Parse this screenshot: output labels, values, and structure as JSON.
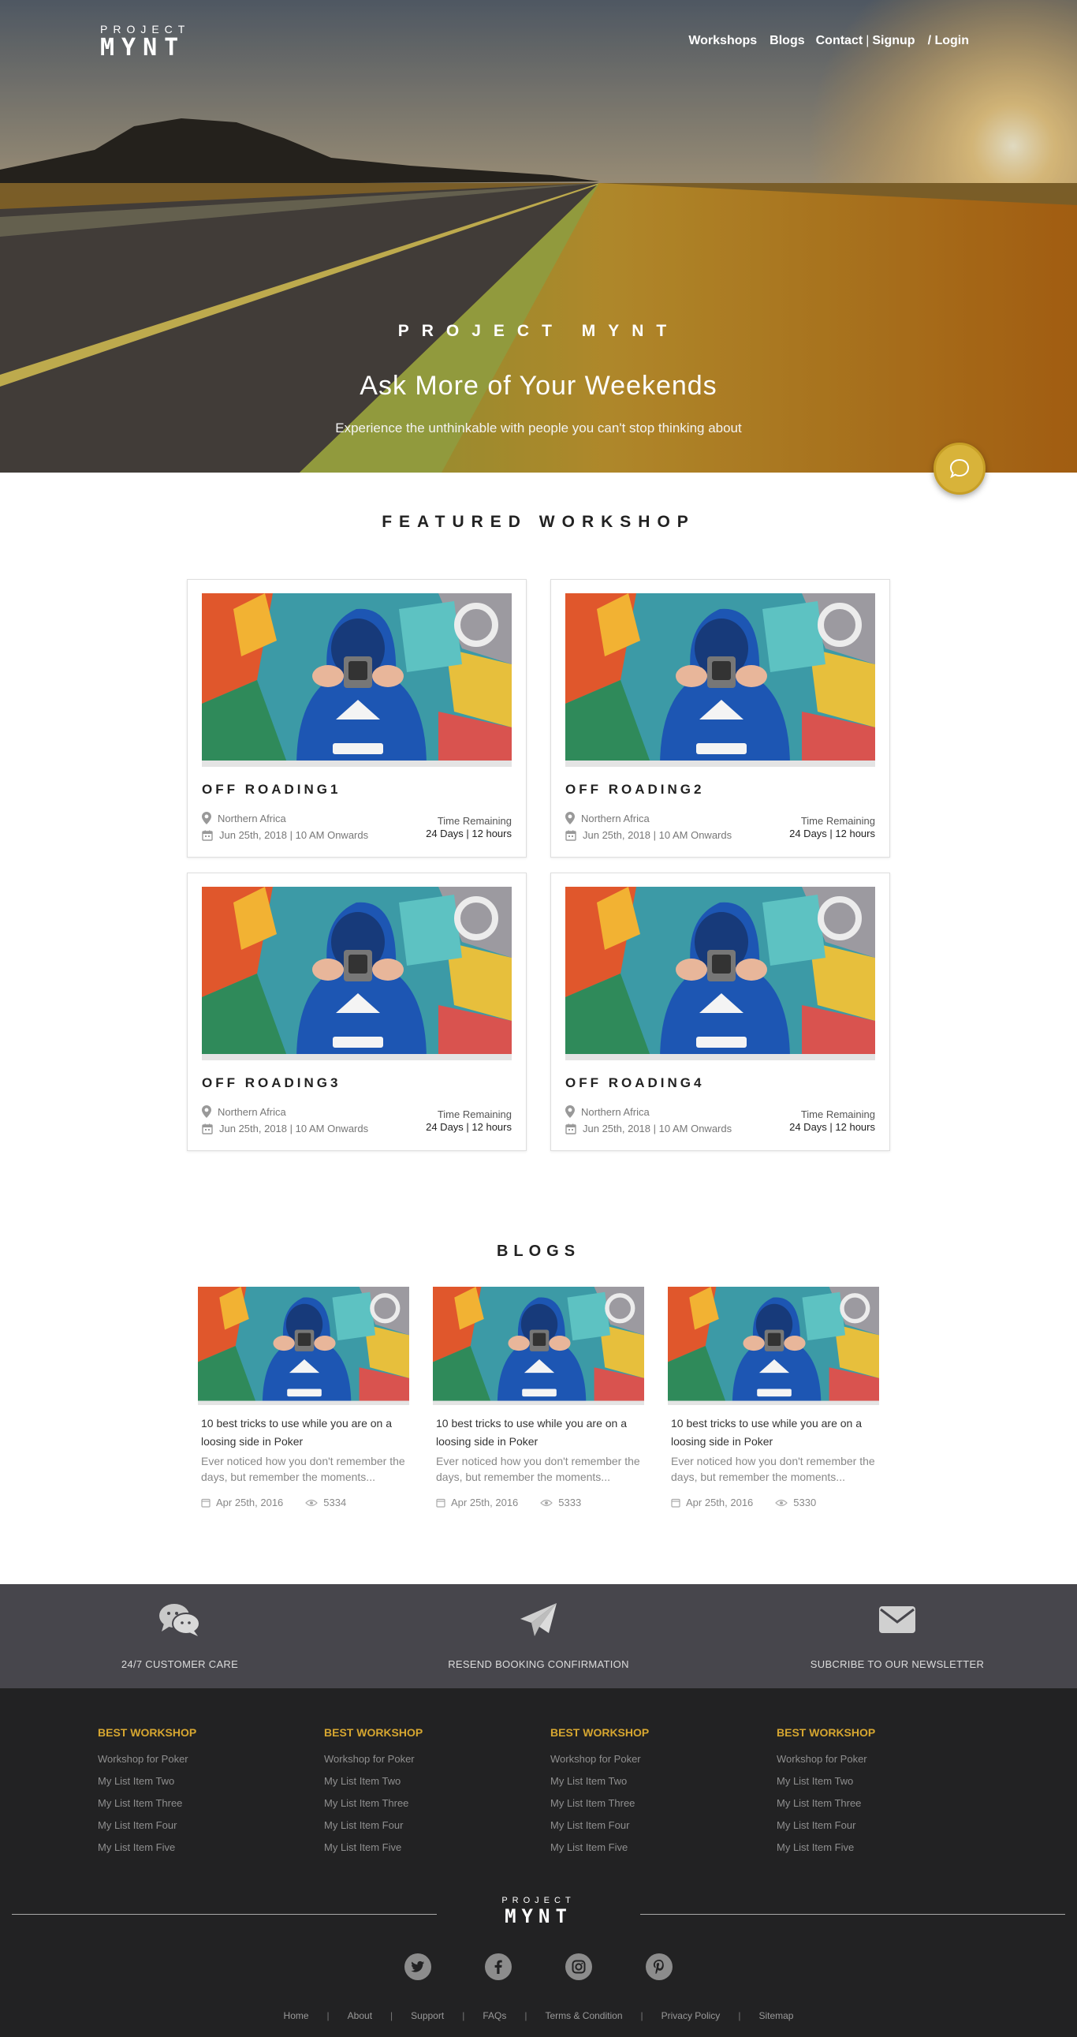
{
  "brand": {
    "top": "PROJECT",
    "bottom": "MYNT"
  },
  "nav": {
    "workshops": "Workshops",
    "blogs": "Blogs",
    "contact": "Contact",
    "separator": "|",
    "signup": "Signup",
    "login": "/ Login"
  },
  "hero": {
    "kicker": "PROJECT MYNT",
    "title": "Ask More of Your Weekends",
    "subtitle": "Experience the unthinkable with people you can't stop thinking about"
  },
  "chat_icon": "chat-bubble-icon",
  "featured": {
    "title": "FEATURED WORKSHOP",
    "cards": [
      {
        "name": "OFF ROADING1",
        "location": "Northern Africa",
        "date": "Jun 25th, 2018 | 10 AM Onwards",
        "remaining_label": "Time Remaining",
        "remaining_value": "24 Days | 12 hours"
      },
      {
        "name": "OFF ROADING2",
        "location": "Northern Africa",
        "date": "Jun 25th, 2018 | 10 AM Onwards",
        "remaining_label": "Time Remaining",
        "remaining_value": "24 Days | 12 hours"
      },
      {
        "name": "OFF ROADING3",
        "location": "Northern Africa",
        "date": "Jun 25th, 2018 | 10 AM Onwards",
        "remaining_label": "Time Remaining",
        "remaining_value": "24 Days | 12 hours"
      },
      {
        "name": "OFF ROADING4",
        "location": "Northern Africa",
        "date": "Jun 25th, 2018 | 10 AM Onwards",
        "remaining_label": "Time Remaining",
        "remaining_value": "24 Days | 12 hours"
      }
    ]
  },
  "blogs": {
    "title": "BLOGS",
    "items": [
      {
        "title": "10 best tricks to use while you are on a loosing side in Poker",
        "excerpt": "Ever noticed how you don't remember the days, but remember the moments...",
        "date": "Apr 25th, 2016",
        "views": "5334"
      },
      {
        "title": "10 best tricks to use while you are on a loosing side in Poker",
        "excerpt": "Ever noticed how you don't remember the days, but remember the moments...",
        "date": "Apr 25th, 2016",
        "views": "5333"
      },
      {
        "title": "10 best tricks to use while you are on a loosing side in Poker",
        "excerpt": "Ever noticed how you don't remember the days, but remember the moments...",
        "date": "Apr 25th, 2016",
        "views": "5330"
      }
    ]
  },
  "services": [
    {
      "label": "24/7 CUSTOMER CARE",
      "icon": "chat-bubbles-icon"
    },
    {
      "label": "RESEND BOOKING CONFIRMATION",
      "icon": "paper-plane-icon"
    },
    {
      "label": "SUBCRIBE TO OUR NEWSLETTER",
      "icon": "envelope-icon"
    }
  ],
  "footer": {
    "columns": [
      {
        "heading": "BEST WORKSHOP",
        "items": [
          "Workshop for Poker",
          "My List Item Two",
          "My List Item Three",
          "My List Item Four",
          "My List Item Five"
        ]
      },
      {
        "heading": "BEST WORKSHOP",
        "items": [
          "Workshop for Poker",
          "My List Item Two",
          "My List Item Three",
          "My List Item Four",
          "My List Item Five"
        ]
      },
      {
        "heading": "BEST WORKSHOP",
        "items": [
          "Workshop for Poker",
          "My List Item Two",
          "My List Item Three",
          "My List Item Four",
          "My List Item Five"
        ]
      },
      {
        "heading": "BEST WORKSHOP",
        "items": [
          "Workshop for Poker",
          "My List Item Two",
          "My List Item Three",
          "My List Item Four",
          "My List Item Five"
        ]
      }
    ],
    "social": [
      "twitter-icon",
      "facebook-icon",
      "instagram-icon",
      "pinterest-icon"
    ],
    "links": [
      "Home",
      "About",
      "Support",
      "FAQs",
      "Terms & Condition",
      "Privacy Policy",
      "Sitemap"
    ],
    "link_separator": "|"
  },
  "colors": {
    "accent": "#d6a630",
    "service_bar": "#47464c",
    "footer_bg": "#222223"
  }
}
